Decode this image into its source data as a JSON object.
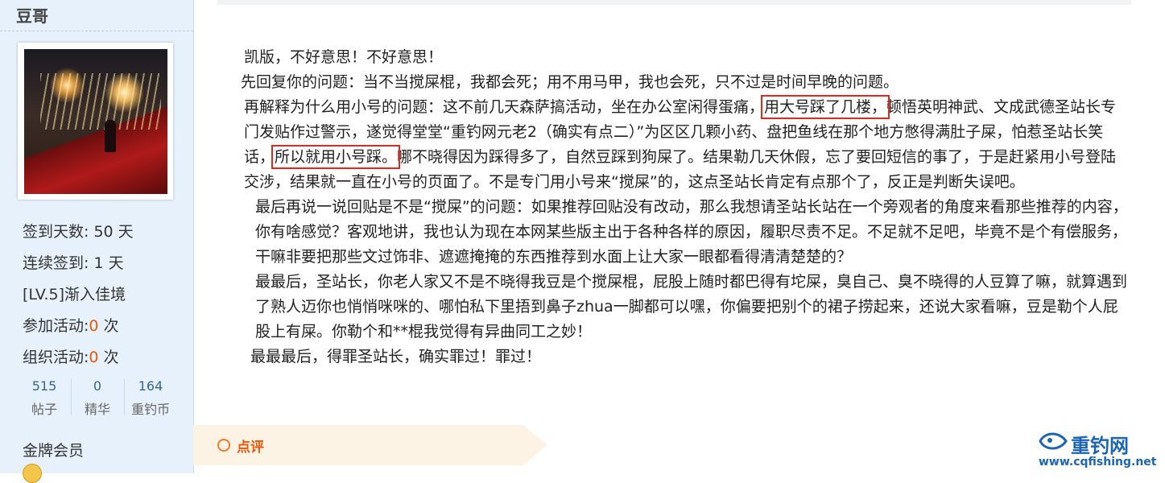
{
  "sidebar": {
    "username": "豆哥",
    "stats": [
      {
        "label": "签到天数: ",
        "value": "50",
        "unit": " 天"
      },
      {
        "label": "连续签到: ",
        "value": "1",
        "unit": " 天"
      },
      {
        "label": "[LV.5]渐入佳境",
        "value": "",
        "unit": ""
      },
      {
        "label": "参加活动:",
        "value": "0",
        "unit": " 次"
      },
      {
        "label": "组织活动:",
        "value": "0",
        "unit": " 次"
      }
    ],
    "counts": [
      {
        "num": "515",
        "label": "帖子"
      },
      {
        "num": "0",
        "label": "精华"
      },
      {
        "num": "164",
        "label": "重钓币"
      }
    ],
    "member_level": "金牌会员"
  },
  "post": {
    "p1": "凯版，不好意思！不好意思！",
    "p2": "先回复你的问题：当不当搅屎棍，我都会死；用不用马甲，我也会死，只不过是时间早晚的问题。",
    "p3_a": "再解释为什么用小号的问题：这不前几天森萨搞活动，坐在办公室闲得蛋痛，",
    "p3_hl1": "用大号踩了几楼，",
    "p3_b": "顿悟英明神武、文成武德圣站长专门发贴作过警示，遂觉得堂堂“重钓网元老2（确实有点二）”为区区几颗小药、盘把鱼线在那个地方憋得满肚子屎，怕惹圣站长笑话，",
    "p3_hl2": "所以就用小号踩。",
    "p3_c": "哪不晓得因为踩得多了，自然豆踩到狗屎了。结果勒几天休假，忘了要回短信的事了，于是赶紧用小号登陆交涉，结果就一直在小号的页面了。不是专门用小号来“搅屎”的，这点圣站长肯定有点那个了，反正是判断失误吧。",
    "p4": "最后再说一说回贴是不是“搅屎”的问题：如果推荐回贴没有改动，那么我想请圣站长站在一个旁观者的角度来看那些推荐的内容，你有啥感觉？客观地讲，我也认为现在本网某些版主出于各种各样的原因，履职尽责不足。不足就不足吧，毕竟不是个有偿服务，干嘛非要把那些文过饰非、遮遮掩掩的东西推荐到水面上让大家一眼都看得清清楚楚的？",
    "p5": "最最后，圣站长，你老人家又不是不晓得我豆是个搅屎棍，屁股上随时都巴得有坨屎，臭自己、臭不晓得的人豆算了嘛，就算遇到了熟人迈你也悄悄咪咪的、哪怕私下里捂到鼻子zhua一脚都可以嘿，你偏要把别个的裙子捞起来，还说大家看嘛，豆是勒个人屁股上有屎。你勒个和**棍我觉得有异曲同工之妙！",
    "p6": "最最最后，得罪圣站长，确实罪过！罪过！"
  },
  "comment": {
    "label": "点评"
  },
  "watermark": {
    "brand": "重钓网",
    "url": "www.cqfishing.net"
  },
  "colors": {
    "accent": "#e8580c",
    "highlight_box": "#e0281f",
    "link": "#336699",
    "sidebar_bg": "#e7f1fb"
  }
}
